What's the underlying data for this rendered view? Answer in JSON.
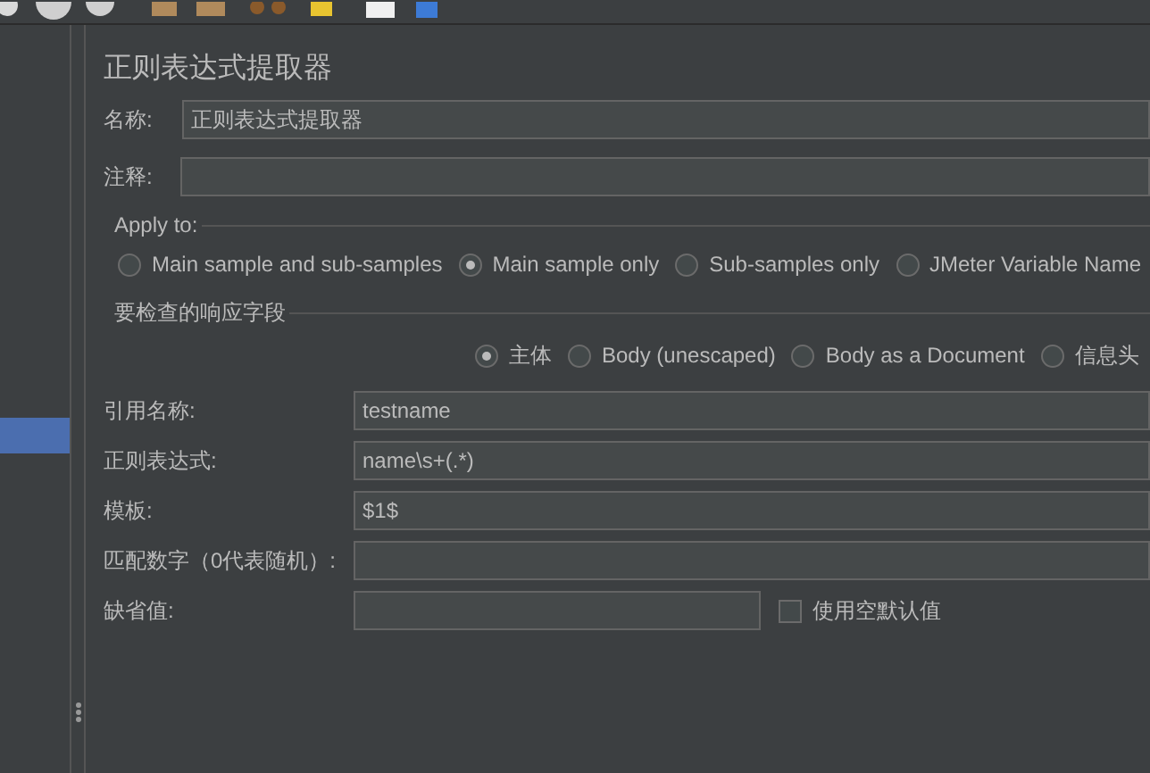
{
  "title": "正则表达式提取器",
  "name_field": {
    "label": "名称:",
    "value": "正则表达式提取器"
  },
  "comment_field": {
    "label": "注释:"
  },
  "apply_to": {
    "legend": "Apply to:",
    "options": [
      {
        "label": "Main sample and sub-samples",
        "selected": false
      },
      {
        "label": "Main sample only",
        "selected": true
      },
      {
        "label": "Sub-samples only",
        "selected": false
      },
      {
        "label": "JMeter Variable Name",
        "selected": false
      }
    ]
  },
  "response_field": {
    "legend": "要检查的响应字段",
    "options": [
      {
        "label": "主体",
        "selected": true
      },
      {
        "label": "Body (unescaped)",
        "selected": false
      },
      {
        "label": "Body as a Document",
        "selected": false
      },
      {
        "label": "信息头",
        "selected": false
      }
    ]
  },
  "extractor_fields": [
    {
      "label": "引用名称:",
      "value": "testname"
    },
    {
      "label": "正则表达式:",
      "value": "name\\s+(.*)"
    },
    {
      "label": "模板:",
      "value": "$1$"
    },
    {
      "label": "匹配数字（0代表随机）:"
    }
  ],
  "default_value": {
    "label": "缺省值:",
    "checkbox": {
      "label": "使用空默认值",
      "checked": false
    }
  }
}
